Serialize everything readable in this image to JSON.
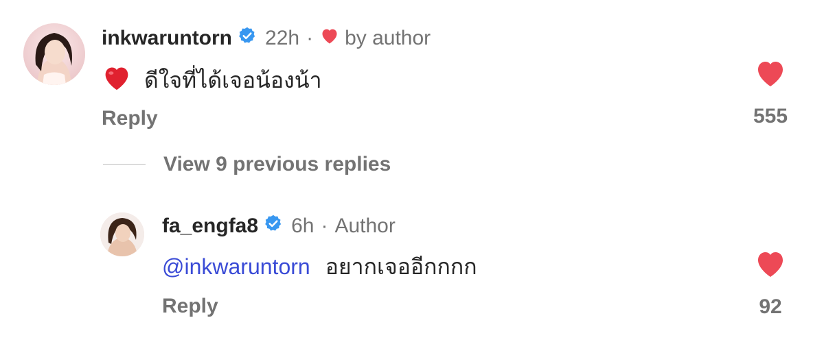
{
  "comment": {
    "username": "inkwaruntorn",
    "time": "22h",
    "separator": "·",
    "liked_by_author": "by author",
    "emoji": "❤️",
    "text": "ดีใจที่ได้เจอน้องน้า",
    "reply_label": "Reply",
    "like_count": "555"
  },
  "view_replies": "View 9 previous replies",
  "reply": {
    "username": "fa_engfa8",
    "time": "6h",
    "separator": "·",
    "author_tag": "Author",
    "mention": "@inkwaruntorn",
    "text": "อยากเจออีกกกก",
    "reply_label": "Reply",
    "like_count": "92"
  },
  "colors": {
    "heart": "#ed4956",
    "verified": "#3897f0",
    "mention": "#3a4bd6",
    "secondary_text": "#737373"
  },
  "icons": [
    "verified-badge-icon",
    "heart-icon",
    "like-heart-icon"
  ]
}
